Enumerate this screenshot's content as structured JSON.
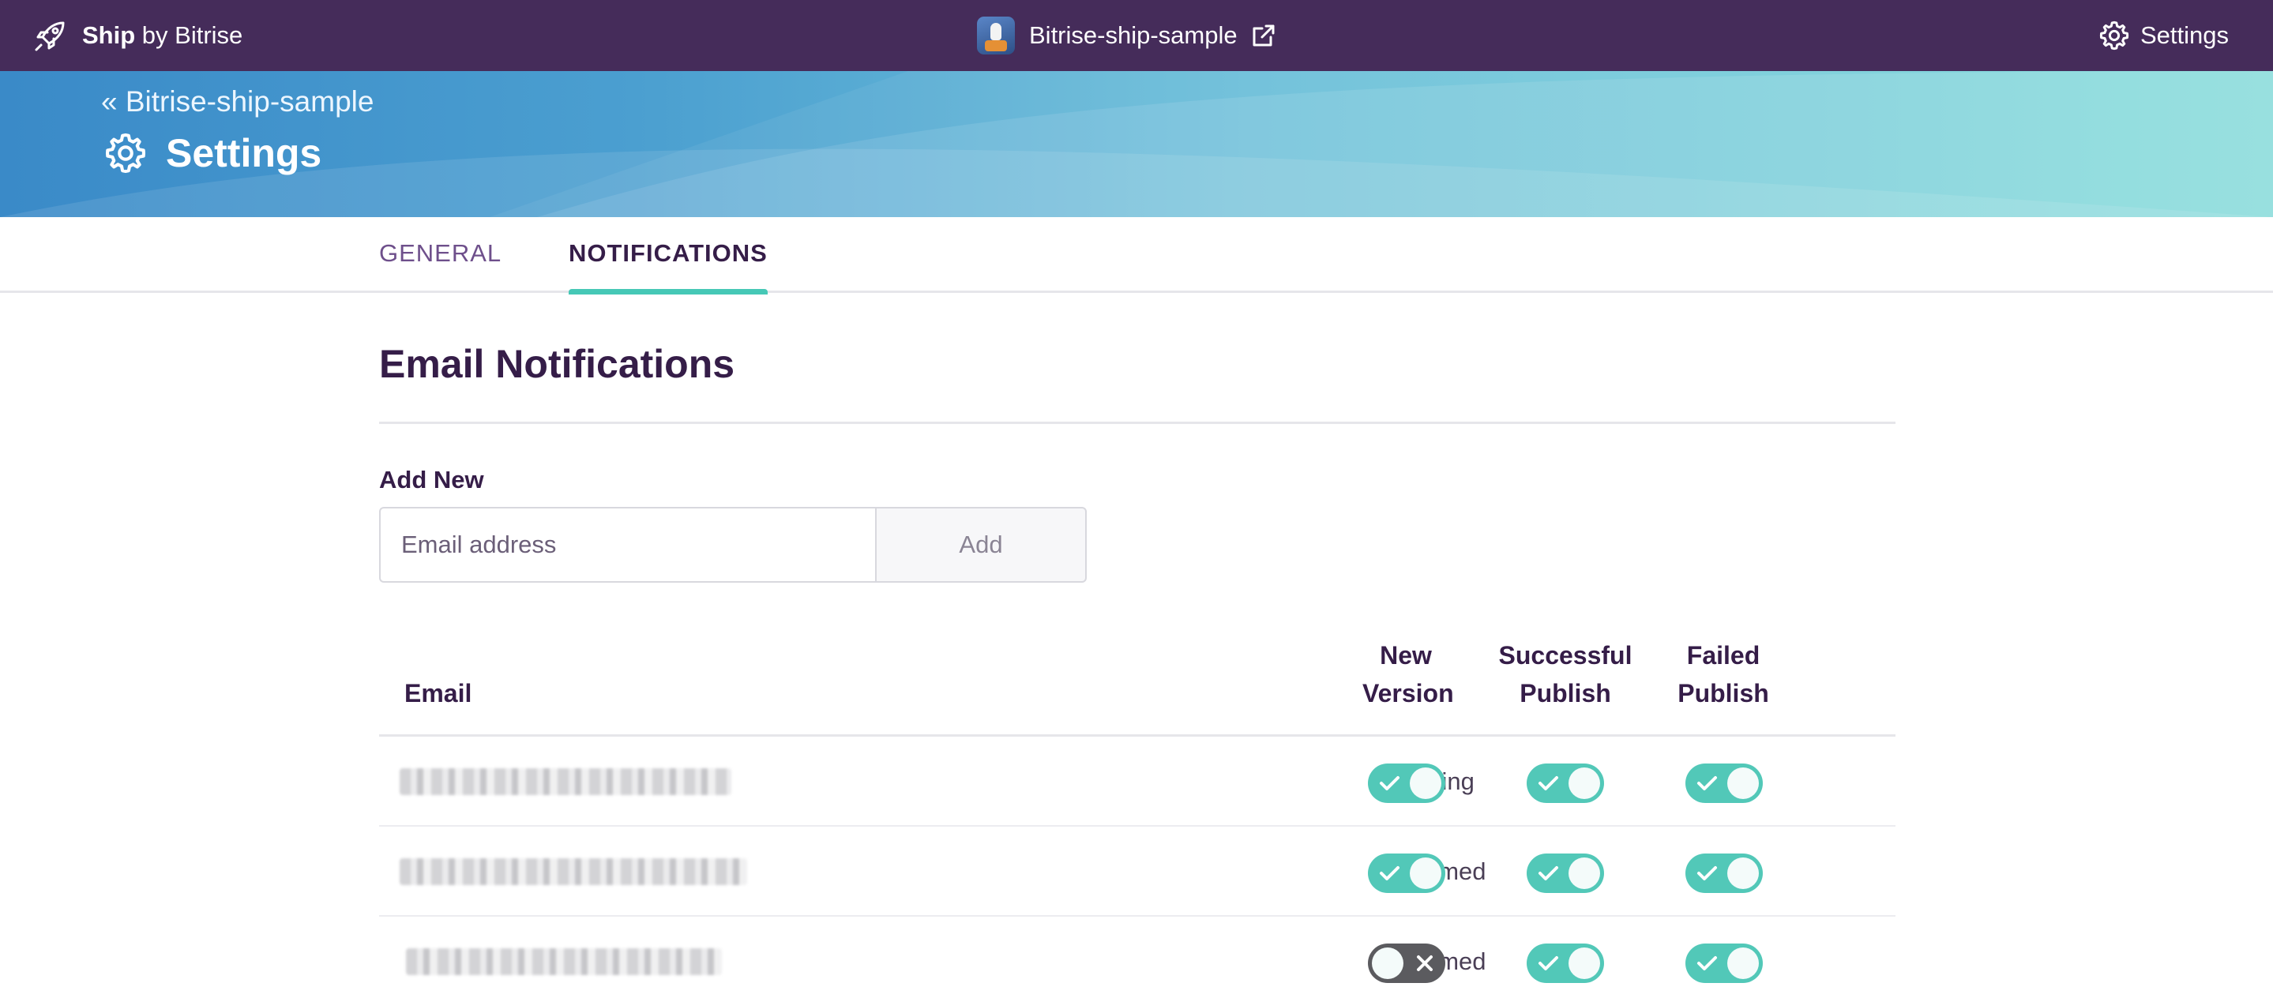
{
  "topbar": {
    "brand_strong": "Ship",
    "brand_rest": " by Bitrise",
    "app_name": "Bitrise-ship-sample",
    "settings_label": "Settings",
    "brand_icon": "rocket-icon",
    "external_icon": "external-link-icon",
    "settings_icon": "gear-icon"
  },
  "hero": {
    "back_link": "« Bitrise-ship-sample",
    "title": "Settings",
    "title_icon": "gear-icon"
  },
  "tabs": [
    {
      "label": "GENERAL",
      "active": false
    },
    {
      "label": "NOTIFICATIONS",
      "active": true
    }
  ],
  "notifications": {
    "section_title": "Email Notifications",
    "add_new_label": "Add New",
    "email_placeholder": "Email address",
    "add_button": "Add"
  },
  "table": {
    "headers": {
      "email": "Email",
      "new_version": "New Version",
      "successful_publish": "Successful Publish",
      "failed_publish": "Failed Publish"
    },
    "rows": [
      {
        "status": "Pending",
        "new_version": true,
        "successful_publish": true,
        "failed_publish": true
      },
      {
        "status": "Confirmed",
        "new_version": true,
        "successful_publish": true,
        "failed_publish": true
      },
      {
        "status": "Confirmed",
        "new_version": false,
        "successful_publish": true,
        "failed_publish": true
      }
    ]
  },
  "colors": {
    "topbar": "#452c5a",
    "accent": "#46c8b6",
    "toggle_on": "#52c8b8",
    "toggle_off": "#5b5b5f",
    "text_primary": "#351d48"
  }
}
